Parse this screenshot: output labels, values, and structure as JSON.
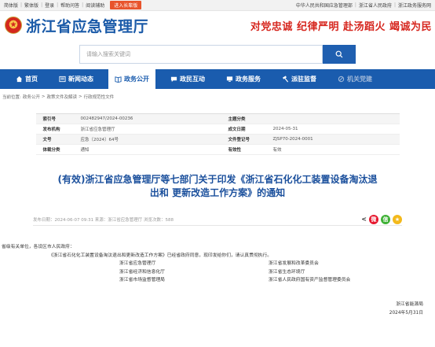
{
  "topbar": {
    "left": [
      "简体版",
      "繁体版",
      "登录",
      "帮助问答",
      "阅读辅助"
    ],
    "elder_mode": "进入长辈版",
    "right": [
      "中华人民共和国应急管理部",
      "浙江省人民政府",
      "浙江政务服务网"
    ]
  },
  "header": {
    "site_title": "浙江省应急管理厅",
    "slogan": "对党忠诚 纪律严明 赴汤蹈火 竭诚为民"
  },
  "search": {
    "placeholder": "请输入搜索关键词"
  },
  "nav": [
    {
      "label": "首页",
      "icon": "home-icon",
      "active": false
    },
    {
      "label": "新闻动态",
      "icon": "newspaper-icon",
      "active": false
    },
    {
      "label": "政务公开",
      "icon": "book-icon",
      "active": true
    },
    {
      "label": "政民互动",
      "icon": "chat-icon",
      "active": false
    },
    {
      "label": "政务服务",
      "icon": "monitor-icon",
      "active": false
    },
    {
      "label": "派驻监督",
      "icon": "hammer-icon",
      "active": false
    },
    {
      "label": "机关党建",
      "icon": "party-icon",
      "active": false,
      "dim": true
    }
  ],
  "breadcrumb": [
    "当前位置:",
    "政务公开",
    ">",
    "政策文件及解读",
    ">",
    "行政规范性文件"
  ],
  "meta": {
    "index_label": "索引号",
    "index_value": "002482947/2024-00236",
    "topic_label": "主题分类",
    "topic_value": "",
    "issuer_label": "发布机构",
    "issuer_value": "浙江省应急管理厅",
    "date_label": "成文日期",
    "date_value": "2024-05-31",
    "docno_label": "文号",
    "docno_value": "应急〔2024〕64号",
    "reg_label": "文件登记号",
    "reg_value": "ZJSP70-2024-0001",
    "type_label": "体裁分类",
    "type_value": "通知",
    "valid_label": "有效性",
    "valid_value": "有效"
  },
  "doc": {
    "title_line1": "(有效)浙江省应急管理厅等七部门关于印发《浙江省石化化工装置设备淘汰退",
    "title_line2": "出和 更新改造工作方案》的通知",
    "publish_info": "发布日期：2024-06-07 09:31   来源：浙江省应急管理厅   浏览次数：588",
    "share_label": "<"
  },
  "content": {
    "greeting": "省级有关单位，各设区市人民政府：",
    "paragraph": "《浙江省石化化工装置设备淘汰退出和更新改造工作方案》已经省政府同意，现印发给你们，请认真贯彻执行。",
    "units": [
      "浙江省应急管理厅",
      "浙江省发展和改革委员会",
      "浙江省经济和信息化厅",
      "浙江省生态环境厅",
      "浙江省市场监督管理局",
      "浙江省人民政府国有资产监督管理委员会"
    ],
    "sign_org": "浙江省能源局",
    "sign_date": "2024年5月31日"
  },
  "colors": {
    "brand_blue": "#1a5cae",
    "title_blue": "#1a4f9c",
    "slogan_red": "#d6261e",
    "elder_orange": "#e8542c"
  }
}
